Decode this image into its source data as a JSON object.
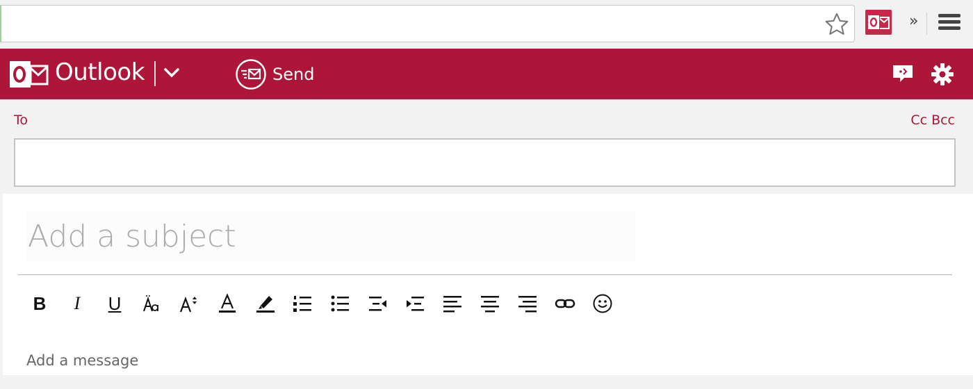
{
  "browser": {
    "address_value": "",
    "icons": [
      "star-icon",
      "outlook-extension-icon",
      "more-extensions-chevron",
      "browser-menu-icon"
    ],
    "more_glyph": "»"
  },
  "header": {
    "app_name": "Outlook",
    "send_label": "Send",
    "brand_color": "#ad1639",
    "icons": [
      "outlook-logo-icon",
      "app-switcher-chevron-icon",
      "send-icon",
      "feedback-icon",
      "gear-icon"
    ]
  },
  "compose": {
    "to_label": "To",
    "cc_bcc_label": "Cc Bcc",
    "to_value": "",
    "subject_placeholder": "Add a subject",
    "message_placeholder": "Add a message"
  },
  "toolbar": {
    "bold": "B",
    "italic": "I",
    "underline": "U",
    "buttons": [
      "bold",
      "italic",
      "underline",
      "font",
      "font-size",
      "font-color",
      "highlight",
      "numbered-list",
      "bulleted-list",
      "decrease-indent",
      "increase-indent",
      "align-left",
      "align-center",
      "align-right",
      "link",
      "emoji"
    ]
  }
}
